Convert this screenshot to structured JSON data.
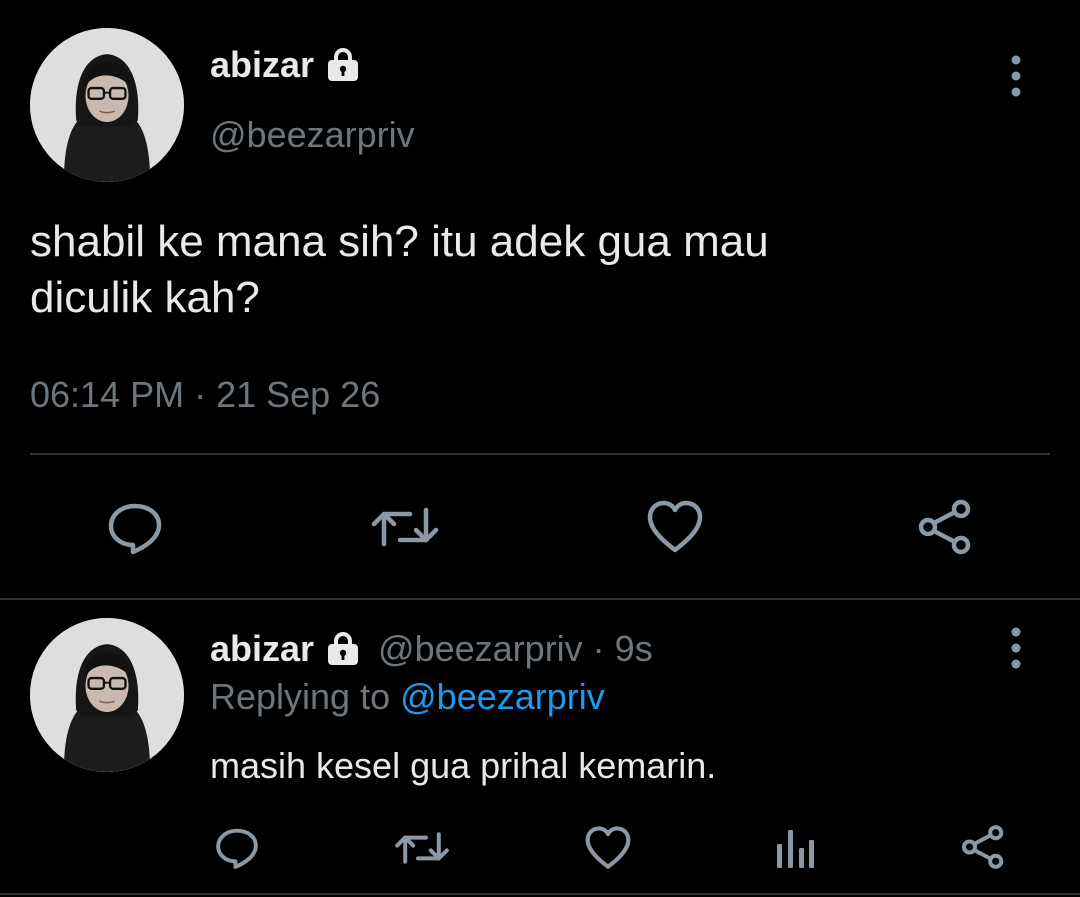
{
  "main_tweet": {
    "display_name": "abizar",
    "handle": "@beezarpriv",
    "text_line1": "shabil ke mana sih? itu adek gua mau",
    "text_line2": "diculik kah?",
    "timestamp": "06:14 PM · 21 Sep 26",
    "icons": {
      "lock": "lock-icon",
      "more": "more-vertical-icon",
      "reply": "reply-icon",
      "retweet": "retweet-icon",
      "like": "heart-icon",
      "share": "share-icon"
    }
  },
  "reply_tweet": {
    "display_name": "abizar",
    "handle_and_time": "@beezarpriv · 9s",
    "replying_prefix": "Replying to",
    "replying_handle": "@beezarpriv",
    "text": "masih kesel gua prihal kemarin.",
    "icons": {
      "lock": "lock-icon",
      "more": "more-vertical-icon",
      "reply": "reply-icon",
      "retweet": "retweet-icon",
      "like": "heart-icon",
      "analytics": "analytics-icon",
      "share": "share-icon"
    }
  },
  "colors": {
    "background": "#000000",
    "primary_text": "#e7e9ea",
    "secondary_text": "#6e767d",
    "link": "#1d9bf0",
    "divider": "#2f3336"
  }
}
